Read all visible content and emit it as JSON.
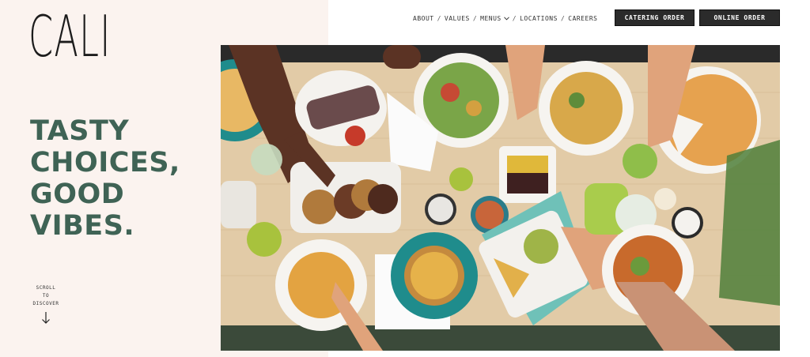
{
  "brand": {
    "logo_text": "CALI"
  },
  "nav": {
    "items": [
      {
        "label": "ABOUT"
      },
      {
        "label": "VALUES"
      },
      {
        "label": "MENUS",
        "has_dropdown": true
      },
      {
        "label": "LOCATIONS"
      },
      {
        "label": "CAREERS"
      }
    ],
    "separator": "/",
    "catering_button": "CATERING ORDER",
    "online_button": "ONLINE ORDER"
  },
  "hero": {
    "heading_lines": [
      "TASTY",
      "CHOICES,",
      "GOOD",
      "VIBES."
    ],
    "scroll_lines": [
      "SCROLL",
      "TO",
      "DISCOVER"
    ],
    "image_icon": "food-table-photo"
  },
  "colors": {
    "left_panel_bg": "#fbf3ef",
    "heading_green": "#3f6355",
    "button_bg": "#2b2b2b",
    "table_wood": "#e4cfae",
    "teal": "#1f8c8c"
  }
}
